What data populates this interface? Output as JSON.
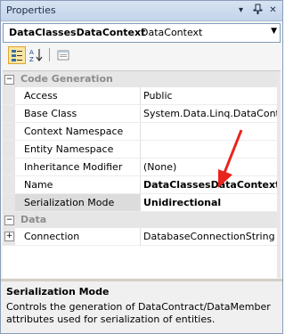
{
  "window": {
    "title": "Properties",
    "dropdown_glyph": "▾",
    "pin_glyph": "ᵖ",
    "close_glyph": "✕"
  },
  "object_selector": {
    "name": "DataClassesDataContext",
    "type": "DataContext",
    "dropdown_glyph": "▼"
  },
  "categories": [
    {
      "label": "Code Generation",
      "expander": "−",
      "properties": [
        {
          "name": "Access",
          "value": "Public",
          "bold": false
        },
        {
          "name": "Base Class",
          "value": "System.Data.Linq.DataContext",
          "bold": false
        },
        {
          "name": "Context Namespace",
          "value": "",
          "bold": false
        },
        {
          "name": "Entity Namespace",
          "value": "",
          "bold": false
        },
        {
          "name": "Inheritance Modifier",
          "value": "(None)",
          "bold": false
        },
        {
          "name": "Name",
          "value": "DataClassesDataContext",
          "bold": true
        },
        {
          "name": "Serialization Mode",
          "value": "Unidirectional",
          "bold": true,
          "selected": true
        }
      ]
    },
    {
      "label": "Data",
      "expander": "−",
      "properties": [
        {
          "name": "Connection",
          "value": "DatabaseConnectionString (W",
          "bold": false,
          "expander": "+"
        }
      ]
    }
  ],
  "description": {
    "title": "Serialization Mode",
    "text": "Controls the generation of DataContract/DataMember attributes used for serialization of entities."
  },
  "colors": {
    "accent": "#e2a431",
    "annotation_arrow": "#e8241c"
  }
}
